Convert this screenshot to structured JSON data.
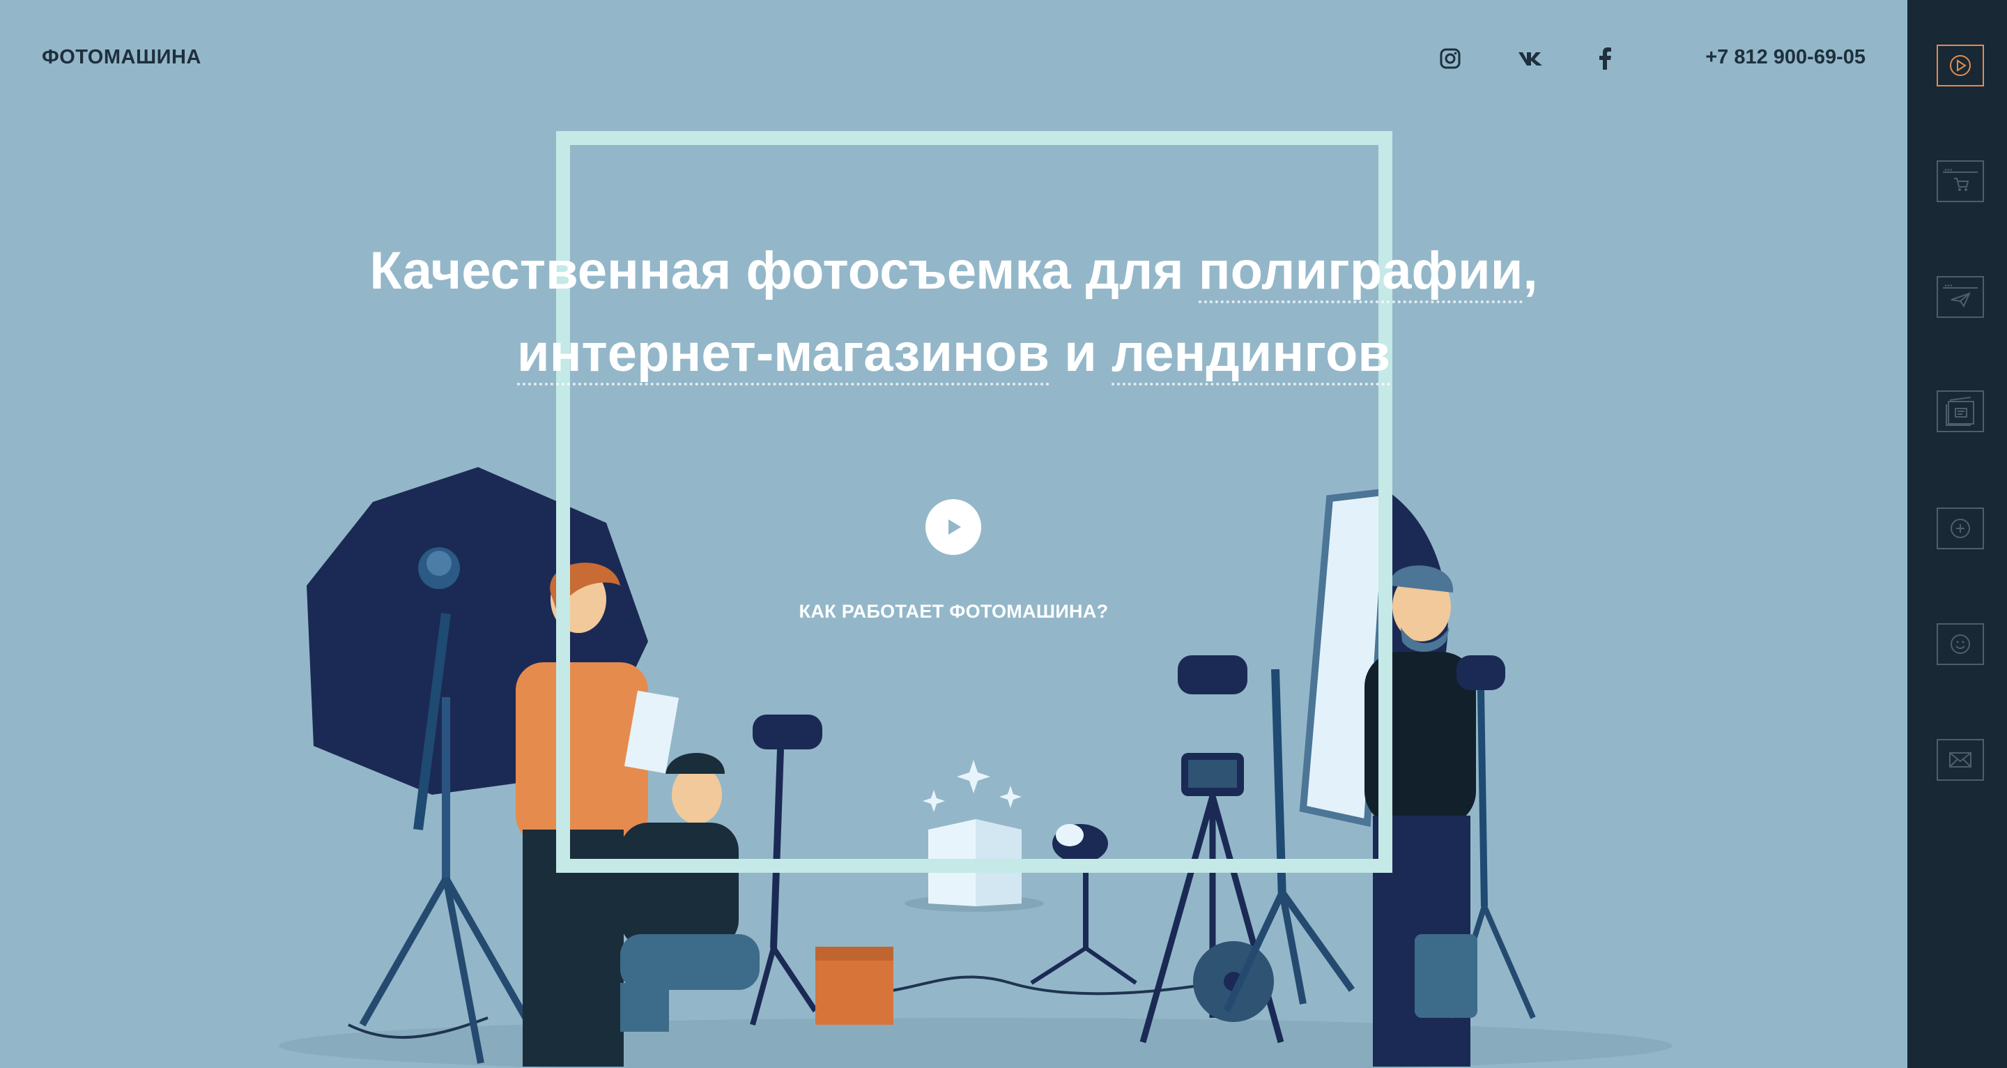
{
  "header": {
    "logo": "ФОТОМАШИНА",
    "phone": "+7 812 900-69-05",
    "social": [
      {
        "icon": "instagram-icon"
      },
      {
        "icon": "vk-icon"
      },
      {
        "icon": "facebook-icon"
      }
    ]
  },
  "hero": {
    "headline_part1": "Качественная фотосъемка для ",
    "headline_link1": "полиграфии",
    "headline_part2": ",",
    "headline_link2": "интернет-магазинов",
    "headline_part3": " и ",
    "headline_link3": "лендингов",
    "how_it_works": "КАК РАБОТАЕТ ФОТОМАШИНА?"
  },
  "sidebar": {
    "items": [
      {
        "icon": "play-icon",
        "active": true
      },
      {
        "icon": "cart-window-icon",
        "active": false
      },
      {
        "icon": "paper-plane-window-icon",
        "active": false
      },
      {
        "icon": "documents-icon",
        "active": false
      },
      {
        "icon": "plus-circle-icon",
        "active": false
      },
      {
        "icon": "smiley-icon",
        "active": false
      },
      {
        "icon": "envelope-icon",
        "active": false
      }
    ]
  },
  "colors": {
    "background": "#93b7c9",
    "sidebar": "#182834",
    "frame": "#c4e9e6",
    "accent": "#e58b4e",
    "dark_text": "#1e2f3d"
  }
}
